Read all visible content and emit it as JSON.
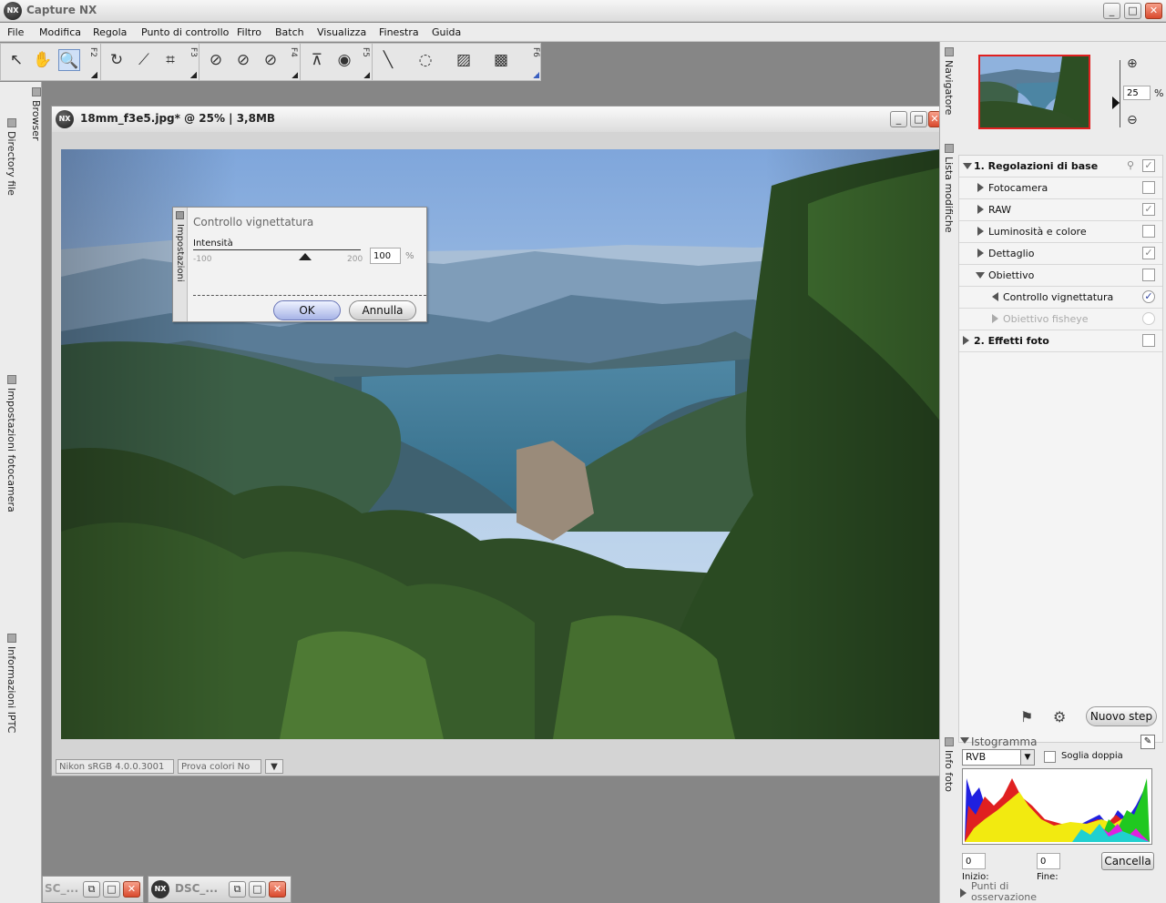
{
  "app": {
    "title": "Capture NX",
    "logo_text": "NX"
  },
  "window_controls": {
    "minimize": "_",
    "maximize": "□",
    "close": "✕"
  },
  "menu": [
    "File",
    "Modifica",
    "Regola",
    "Punto di controllo",
    "Filtro",
    "Batch",
    "Visualizza",
    "Finestra",
    "Guida"
  ],
  "toolbar": {
    "fkeys": [
      "F2",
      "F3",
      "F4",
      "F5",
      "F6"
    ],
    "icons": [
      "select-arrow-icon",
      "hand-pan-icon",
      "zoom-icon",
      "rotate-icon",
      "straighten-icon",
      "crop-icon",
      "black-point-icon",
      "white-point-icon",
      "neutral-point-icon",
      "red-eye-icon",
      "auto-retouch-icon",
      "lasso-icon",
      "marquee-icon",
      "gradient-icon",
      "fill-icon"
    ]
  },
  "left_panel": {
    "tabs": [
      "Browser",
      "Directory file",
      "Impostazioni fotocamera",
      "Informazioni IPTC"
    ]
  },
  "document": {
    "title": "18mm_f3e5.jpg* @ 25% | 3,8MB",
    "logo_text": "NX",
    "status_profile": "Nikon sRGB 4.0.0.3001",
    "status_proof": "Prova colori No"
  },
  "vignette_dialog": {
    "tab_label": "Impostazioni",
    "title": "Controllo vignettatura",
    "slider_label": "Intensità",
    "min": "-100",
    "max": "200",
    "value": "100",
    "unit": "%",
    "intensity_fraction": 0.667,
    "ok": "OK",
    "cancel": "Annulla"
  },
  "docked_docs": [
    {
      "title": "SC_..."
    },
    {
      "title": "DSC_..."
    }
  ],
  "navigator": {
    "tab_label": "Navigatore",
    "zoom_value": "25",
    "zoom_unit": "%"
  },
  "edit_list": {
    "tab_label": "Lista modifiche",
    "items": [
      {
        "label": "1. Regolazioni di base",
        "bold": true,
        "checked": true
      },
      {
        "label": "Fotocamera",
        "checked": false
      },
      {
        "label": "RAW",
        "checked": true
      },
      {
        "label": "Luminosità e colore",
        "checked": false
      },
      {
        "label": "Dettaglio",
        "checked": true
      },
      {
        "label": "Obiettivo",
        "checked": false
      },
      {
        "label": "Controllo vignettatura",
        "checked": true
      },
      {
        "label": "Obiettivo fisheye",
        "checked": false
      },
      {
        "label": "2. Effetti foto",
        "bold": true,
        "checked": false
      }
    ],
    "new_step": "Nuovo step"
  },
  "info": {
    "tab_label": "Info foto",
    "histogram_title": "Istogramma",
    "channel": "RVB",
    "double_threshold": "Soglia doppia",
    "start_value": "0",
    "end_value": "0",
    "start_label": "Inizio:",
    "end_label": "Fine:",
    "cancel": "Cancella",
    "watch_points": "Punti di osservazione"
  }
}
